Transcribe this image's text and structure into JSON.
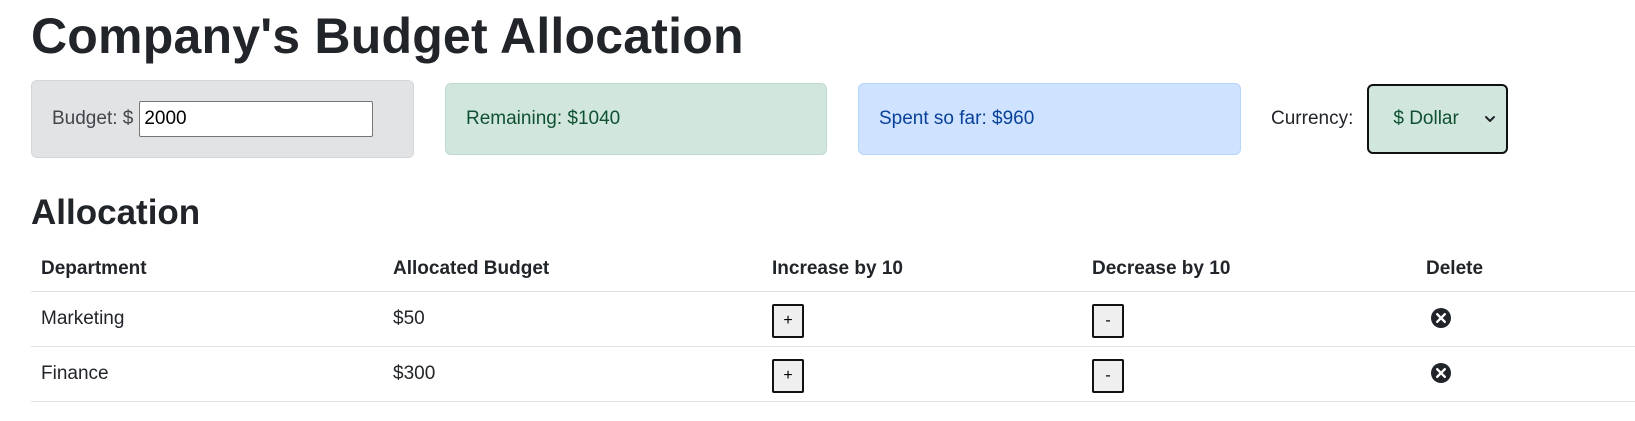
{
  "page": {
    "title": "Company's Budget Allocation"
  },
  "summary": {
    "budget_label": "Budget: $",
    "budget_value": "2000",
    "remaining_text": "Remaining: $1040",
    "spent_text": "Spent so far: $960",
    "currency_label": "Currency:",
    "currency_selected": "$ Dollar"
  },
  "allocation": {
    "heading": "Allocation",
    "columns": [
      "Department",
      "Allocated Budget",
      "Increase by 10",
      "Decrease by 10",
      "Delete"
    ],
    "rows": [
      {
        "department": "Marketing",
        "budget": "$50",
        "increase_label": "+",
        "decrease_label": "-"
      },
      {
        "department": "Finance",
        "budget": "$300",
        "increase_label": "+",
        "decrease_label": "-"
      }
    ]
  },
  "colors": {
    "budget_bg": "#e2e3e5",
    "remaining_bg": "#d1e7dd",
    "spent_bg": "#cfe2ff",
    "currency_bg": "#d1e7dd"
  },
  "icons": {
    "delete": "close-circle-icon",
    "currency_dropdown": "chevron-down-icon"
  }
}
